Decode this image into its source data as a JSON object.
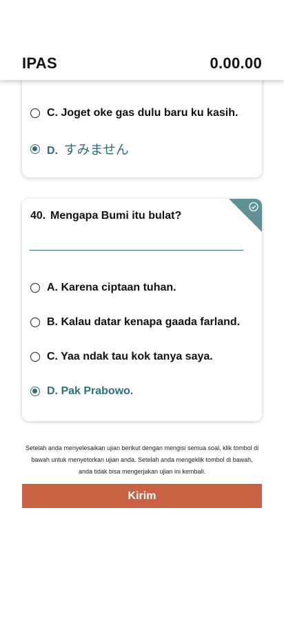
{
  "header": {
    "subject": "IPAS",
    "timer": "0.00.00"
  },
  "prev_question": {
    "options": [
      {
        "letter": "C.",
        "text": "Joget oke gas dulu baru ku kasih.",
        "selected": false
      },
      {
        "letter": "D.",
        "text": "すみません",
        "selected": true
      }
    ]
  },
  "question": {
    "number": "40.",
    "text": "Mengapa Bumi itu bulat?",
    "options": [
      {
        "text": "A. Karena ciptaan tuhan.",
        "selected": false
      },
      {
        "text": "B. Kalau datar kenapa gaada farland.",
        "selected": false
      },
      {
        "text": "C. Yaa ndak tau kok tanya saya.",
        "selected": false
      },
      {
        "text": "D. Pak Prabowo.",
        "selected": true
      }
    ],
    "answered_icon": "check-circle-icon"
  },
  "footer": {
    "notice": "Setelah anda menyelesaikan ujian berikut dengan mengisi semua soal, klik tombol di bawah untuk menyetorkan ujian anda. Setelah anda mengeklik tombol di bawah, anda tidak bisa mengerjakan ujian ini kembali.",
    "submit_label": "Kirim"
  },
  "colors": {
    "accent": "#2e6f7c",
    "submit": "#c96242",
    "corner": "#5f9197"
  }
}
